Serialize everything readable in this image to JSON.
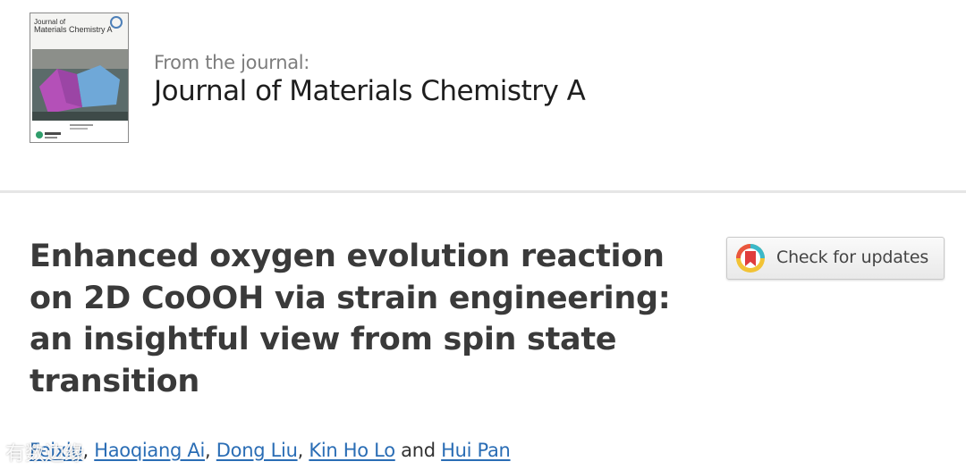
{
  "journal": {
    "from_label": "From the journal:",
    "name": "Journal of Materials Chemistry A",
    "cover": {
      "title_line1": "Journal of",
      "title_line2": "Materials Chemistry A"
    }
  },
  "article": {
    "title": "Enhanced oxygen evolution reaction on 2D CoOOH via strain engineering: an insightful view from spin state transition",
    "check_updates_label": "Check for updates",
    "authors": [
      {
        "name": "Feixiu"
      },
      {
        "name": "Haoqiang Ai"
      },
      {
        "name": "Dong Liu"
      },
      {
        "name": "Kin Ho Lo"
      },
      {
        "name": "Hui Pan"
      }
    ],
    "authors_and": "and",
    "author_sep": ","
  },
  "watermark": {
    "text": "有数边缘"
  },
  "colors": {
    "link": "#2a6db5",
    "title": "#3a3a3a",
    "divider": "#e6e6e6"
  }
}
